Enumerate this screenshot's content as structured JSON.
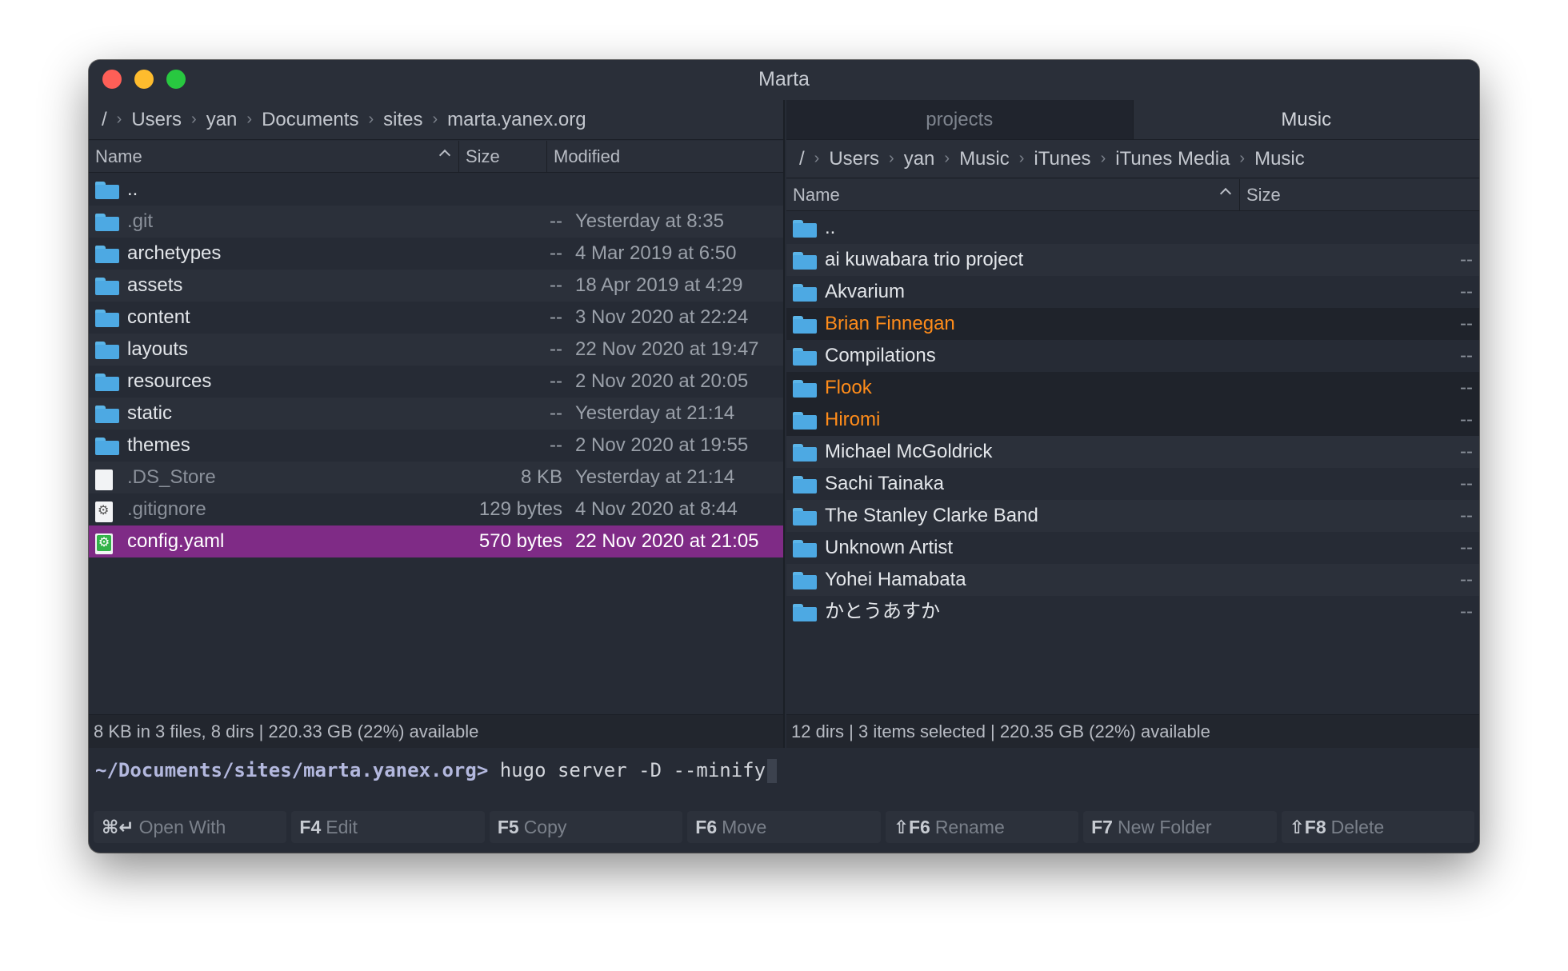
{
  "window": {
    "title": "Marta"
  },
  "left": {
    "breadcrumb": [
      "/",
      "Users",
      "yan",
      "Documents",
      "sites",
      "marta.yanex.org"
    ],
    "columns": {
      "name": "Name",
      "size": "Size",
      "modified": "Modified"
    },
    "rows": [
      {
        "name": "..",
        "size": "",
        "modified": "",
        "icon": "folder-icon"
      },
      {
        "name": ".git",
        "size": "--",
        "modified": "Yesterday at 8:35",
        "icon": "folder-icon"
      },
      {
        "name": "archetypes",
        "size": "--",
        "modified": "4 Mar 2019 at 6:50",
        "icon": "folder-icon"
      },
      {
        "name": "assets",
        "size": "--",
        "modified": "18 Apr 2019 at 4:29",
        "icon": "folder-icon"
      },
      {
        "name": "content",
        "size": "--",
        "modified": "3 Nov 2020 at 22:24",
        "icon": "folder-icon"
      },
      {
        "name": "layouts",
        "size": "--",
        "modified": "22 Nov 2020 at 19:47",
        "icon": "folder-icon"
      },
      {
        "name": "resources",
        "size": "--",
        "modified": "2 Nov 2020 at 20:05",
        "icon": "folder-icon"
      },
      {
        "name": "static",
        "size": "--",
        "modified": "Yesterday at 21:14",
        "icon": "folder-icon"
      },
      {
        "name": "themes",
        "size": "--",
        "modified": "2 Nov 2020 at 19:55",
        "icon": "folder-icon"
      },
      {
        "name": ".DS_Store",
        "size": "8 KB",
        "modified": "Yesterday at 21:14",
        "icon": "file-icon"
      },
      {
        "name": ".gitignore",
        "size": "129 bytes",
        "modified": "4 Nov 2020 at 8:44",
        "icon": "config-file-icon"
      },
      {
        "name": "config.yaml",
        "size": "570 bytes",
        "modified": "22 Nov 2020 at 21:05",
        "icon": "yaml-file-icon"
      }
    ],
    "status": "8 KB in 3 files, 8 dirs  |  220.33 GB (22%) available"
  },
  "right": {
    "tabs": [
      "projects",
      "Music"
    ],
    "breadcrumb": [
      "/",
      "Users",
      "yan",
      "Music",
      "iTunes",
      "iTunes Media",
      "Music"
    ],
    "columns": {
      "name": "Name",
      "size": "Size"
    },
    "rows": [
      {
        "name": "..",
        "size": ""
      },
      {
        "name": "ai kuwabara trio project",
        "size": "--"
      },
      {
        "name": "Akvarium",
        "size": "--"
      },
      {
        "name": "Brian Finnegan",
        "size": "--"
      },
      {
        "name": "Compilations",
        "size": "--"
      },
      {
        "name": "Flook",
        "size": "--"
      },
      {
        "name": "Hiromi",
        "size": "--"
      },
      {
        "name": "Michael McGoldrick",
        "size": "--"
      },
      {
        "name": "Sachi Tainaka",
        "size": "--"
      },
      {
        "name": "The Stanley Clarke Band",
        "size": "--"
      },
      {
        "name": "Unknown Artist",
        "size": "--"
      },
      {
        "name": "Yohei Hamabata",
        "size": "--"
      },
      {
        "name": "かとうあすか",
        "size": "--"
      }
    ],
    "status": "12 dirs  |  3 items selected  |  220.35 GB (22%) available"
  },
  "terminal": {
    "prompt": "~/Documents/sites/marta.yanex.org>",
    "command": " hugo server -D --minify"
  },
  "fkeys": [
    {
      "key": "⌘↵",
      "label": "Open With"
    },
    {
      "key": "F4",
      "label": "Edit"
    },
    {
      "key": "F5",
      "label": "Copy"
    },
    {
      "key": "F6",
      "label": "Move"
    },
    {
      "key": "⇧F6",
      "label": "Rename"
    },
    {
      "key": "F7",
      "label": "New Folder"
    },
    {
      "key": "⇧F8",
      "label": "Delete"
    }
  ],
  "colors": {
    "selection": "#7f2b86",
    "marked": "#ff8c1a",
    "folder": "#4da9e3",
    "background": "#262b35"
  }
}
